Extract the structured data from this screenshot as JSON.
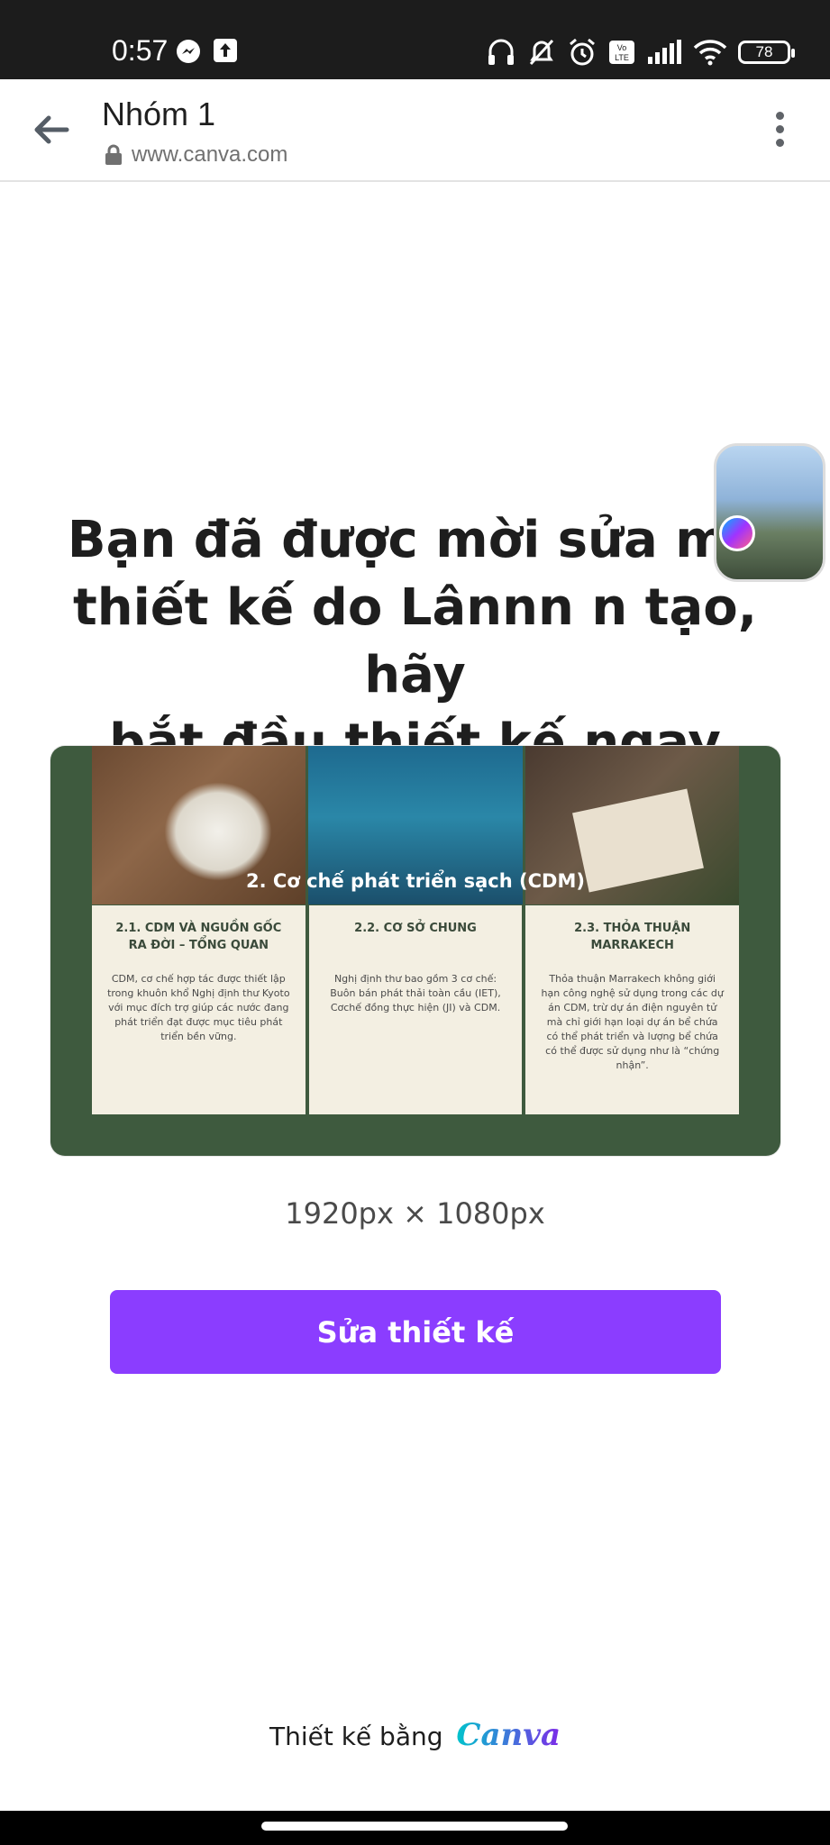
{
  "status_bar": {
    "time": "0:57",
    "battery": "78",
    "left_icons": [
      "messenger-icon",
      "upload-icon"
    ],
    "right_icons": [
      "headphones-icon",
      "bell-muted-icon",
      "alarm-icon",
      "volte-icon",
      "signal-icon",
      "wifi-icon",
      "battery-icon"
    ]
  },
  "browser": {
    "title": "Nhóm 1",
    "url": "www.canva.com"
  },
  "headline": "Bạn đã được mời sửa mộ\nthiết kế do Lânnn n tạo, hãy\nbắt đầu thiết kế ngay",
  "preview": {
    "slide_title": "2. Cơ chế phát triển sạch (CDM)",
    "cards": [
      {
        "title": "2.1. CDM VÀ NGUỒN GỐC RA ĐỜI – TỔNG QUAN",
        "body": "CDM, cơ chế hợp tác được thiết lập trong khuôn khổ Nghị định thư Kyoto với mục đích trợ giúp các nước đang phát triển đạt được mục tiêu phát triển bền vững."
      },
      {
        "title": "2.2. CƠ SỞ CHUNG",
        "body": "Nghị định thư bao gồm 3 cơ chế: Buôn bán phát thải toàn cầu (IET), Cơchế đồng thực hiện (JI) và CDM."
      },
      {
        "title": "2.3. THỎA THUẬN MARRAKECH",
        "body": "Thỏa thuận Marrakech không giới hạn công nghệ sử dụng trong các dự án CDM, trừ dự án điện nguyên tử mà chỉ giới hạn loại dự án bể chứa có thể phát triển và lượng bể chứa có thể được sử dụng như là “chứng nhận”."
      }
    ]
  },
  "dimensions": "1920px × 1080px",
  "edit_button": "Sửa thiết kế",
  "footer": {
    "prefix": "Thiết kế bằng",
    "brand": "Canva"
  },
  "colors": {
    "accent": "#8b3dff",
    "slide_bg": "#3e5a3e",
    "card_bg": "#f3efe2"
  }
}
